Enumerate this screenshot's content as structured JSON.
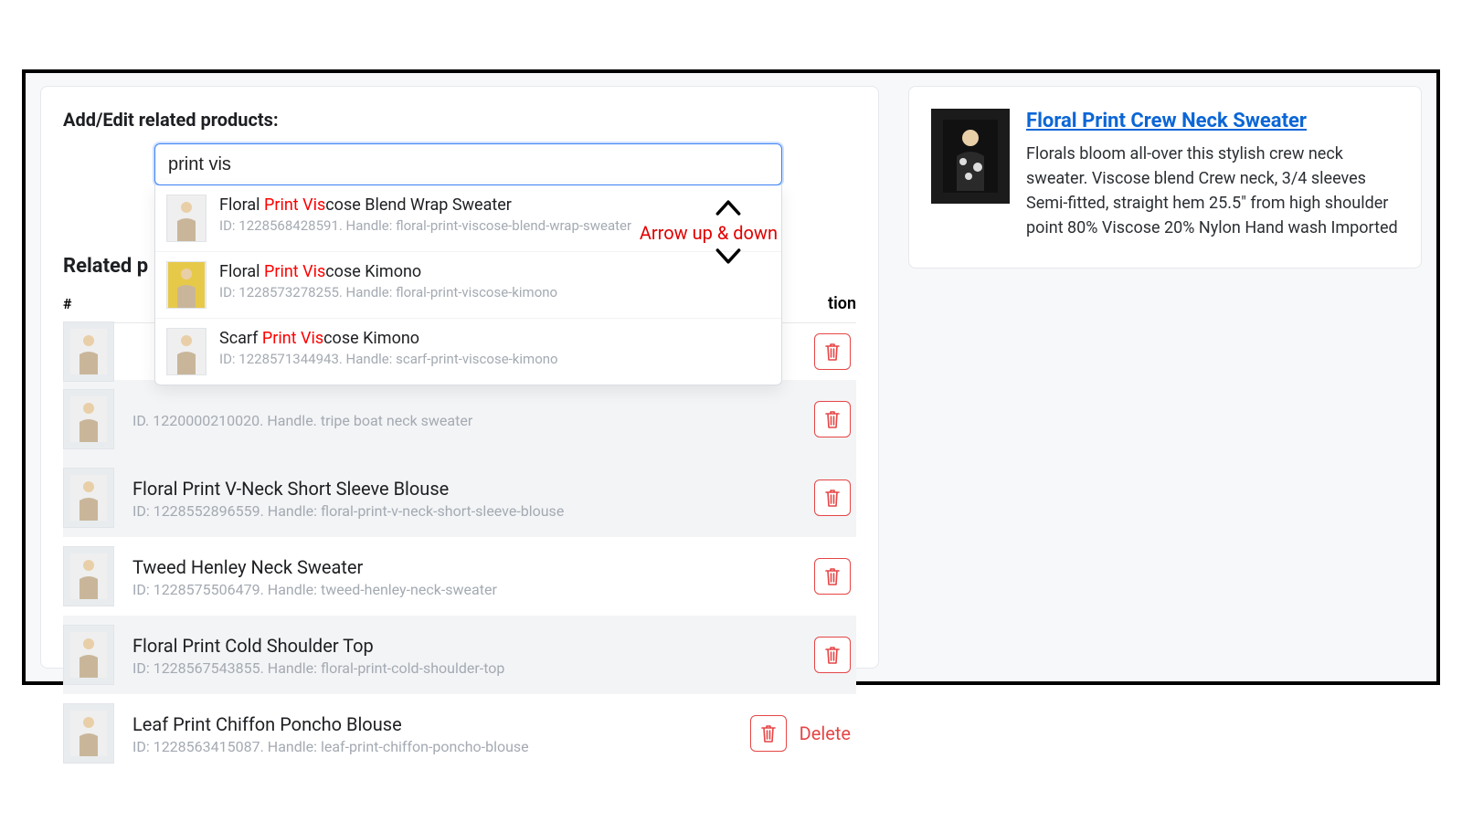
{
  "main": {
    "title": "Add/Edit related products:",
    "search_value": "print vis",
    "suggestions": [
      {
        "name_parts": [
          "Floral ",
          "Print Vis",
          "cose Blend Wrap Sweater"
        ],
        "sub": "ID: 1228568428591. Handle: floral-print-viscose-blend-wrap-sweater"
      },
      {
        "name_parts": [
          "Floral ",
          "Print Vis",
          "cose Kimono"
        ],
        "sub": "ID: 1228573278255. Handle: floral-print-viscose-kimono"
      },
      {
        "name_parts": [
          "Scarf ",
          "Print Vis",
          "cose Kimono"
        ],
        "sub": "ID: 1228571344943. Handle: scarf-print-viscose-kimono"
      }
    ],
    "section_heading": "Related p",
    "th_hash": "#",
    "th_action": "tion",
    "rows": [
      {
        "name": "",
        "sub": "",
        "alt": false,
        "show_delete_label": false
      },
      {
        "name": "",
        "sub": "ID. 1220000210020. Handle. tripe boat neck sweater",
        "alt": true,
        "show_delete_label": false
      },
      {
        "name": "Floral Print V-Neck Short Sleeve Blouse",
        "sub": "ID: 1228552896559. Handle: floral-print-v-neck-short-sleeve-blouse",
        "alt": true,
        "show_delete_label": false
      },
      {
        "name": "Tweed Henley Neck Sweater",
        "sub": "ID: 1228575506479. Handle: tweed-henley-neck-sweater",
        "alt": false,
        "show_delete_label": false
      },
      {
        "name": "Floral Print Cold Shoulder Top",
        "sub": "ID: 1228567543855. Handle: floral-print-cold-shoulder-top",
        "alt": true,
        "show_delete_label": false
      },
      {
        "name": "Leaf Print Chiffon Poncho Blouse",
        "sub": "ID: 1228563415087. Handle: leaf-print-chiffon-poncho-blouse",
        "alt": false,
        "show_delete_label": true
      }
    ],
    "delete_label": "Delete",
    "annotation_label": "Arrow up & down"
  },
  "side": {
    "title": "Floral Print Crew Neck Sweater",
    "desc": "Florals bloom all-over this stylish crew neck sweater.  Viscose blend Crew neck, 3/4 sleeves Semi-fitted, straight hem 25.5\" from high shoulder point 80% Viscose 20% Nylon Hand wash Imported"
  },
  "icons": {
    "trash": "trash-icon",
    "chevron_up": "chevron-up-icon",
    "chevron_down": "chevron-down-icon",
    "person": "person-icon"
  }
}
